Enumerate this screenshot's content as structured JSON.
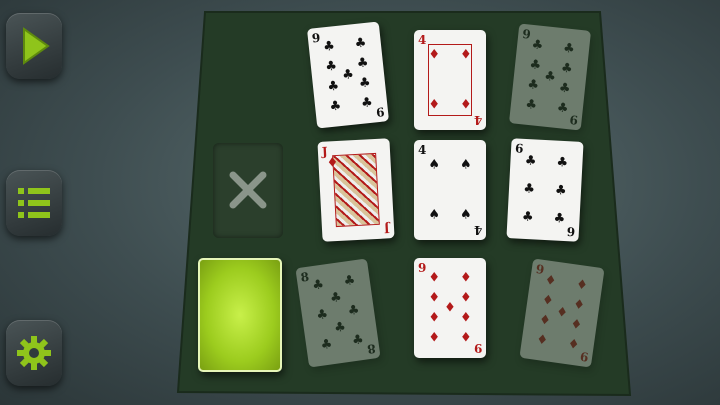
{
  "sidebar": {
    "play_icon": "play-icon",
    "menu_icon": "menu-icon",
    "settings_icon": "gear-icon"
  },
  "cards": [
    {
      "id": "c1",
      "rank": "9",
      "suit": "clubs",
      "color": "black",
      "faded": false
    },
    {
      "id": "c2",
      "rank": "4",
      "suit": "diamonds",
      "color": "red",
      "faded": false
    },
    {
      "id": "c3",
      "rank": "9",
      "suit": "clubs",
      "color": "black",
      "faded": true
    },
    {
      "id": "c4",
      "rank": "J",
      "suit": "diamonds",
      "color": "red",
      "faded": false
    },
    {
      "id": "c5",
      "rank": "4",
      "suit": "spades",
      "color": "black",
      "faded": false
    },
    {
      "id": "c6",
      "rank": "6",
      "suit": "clubs",
      "color": "black",
      "faded": false
    },
    {
      "id": "c7",
      "rank": "8",
      "suit": "clubs",
      "color": "black",
      "faded": true
    },
    {
      "id": "c8",
      "rank": "9",
      "suit": "diamonds",
      "color": "red",
      "faded": false
    },
    {
      "id": "c9",
      "rank": "9",
      "suit": "diamonds",
      "color": "red",
      "faded": true
    }
  ],
  "colors": {
    "felt": "#253d27",
    "accent": "#9ccc1e",
    "red_suit": "#b31a1a"
  }
}
